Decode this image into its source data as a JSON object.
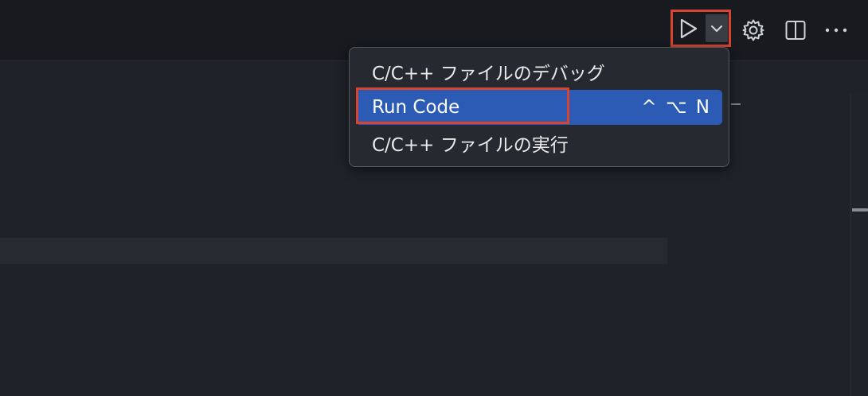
{
  "toolbar": {
    "run_icon": "play-icon",
    "dropdown_icon": "chevron-down-icon",
    "settings_icon": "gear-icon",
    "split_icon": "split-editor-icon",
    "more_icon": "ellipsis-icon"
  },
  "run_menu": {
    "items": [
      {
        "label": "C/C++ ファイルのデバッグ",
        "shortcut": ""
      },
      {
        "label": "Run Code",
        "shortcut": "^ ⌥ N",
        "selected": true
      },
      {
        "label": "C/C++ ファイルの実行",
        "shortcut": ""
      }
    ]
  },
  "colors": {
    "highlight_border": "#d9442f",
    "selected_item_bg": "#2c5bb5"
  }
}
